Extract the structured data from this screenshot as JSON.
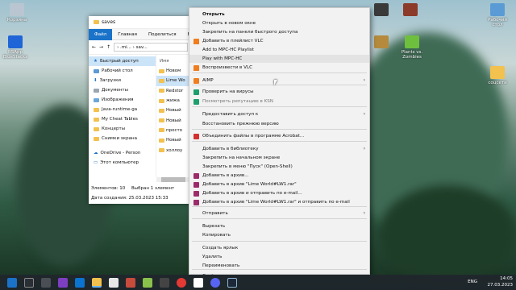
{
  "desktop": {
    "left_icons": [
      "Корзина",
      "BSApp\nBlueStacks"
    ],
    "right_icons": [
      "Рабочий\nстол",
      "Plants vs.\nZombies",
      "соцсети"
    ]
  },
  "explorer": {
    "title": "saves",
    "ribbon_tabs": [
      "Файл",
      "Главная",
      "Поделиться",
      "Вид"
    ],
    "path": "› .mi... › sav...",
    "column_header": "Имя",
    "nav_items": [
      "Быстрый доступ",
      "Рабочий стол",
      "Загрузки",
      "Документы",
      "Изображения",
      "Java-runtime-ga",
      "My Cheat Tables",
      "Концерты",
      "Снимки экрана",
      "OneDrive - Person",
      "Этот компьютер"
    ],
    "file_items": [
      "Новом",
      "Lime Wo",
      "Redstor",
      "жижа",
      "Новый",
      "Новый",
      "просто",
      "Новый",
      "холлоу"
    ],
    "status_elements": "Элементов: 10",
    "status_selected": "Выбран 1 элемент",
    "status_date": "Дата создания: 25.03.2023 15:33"
  },
  "context_menu": {
    "items": [
      {
        "label": "Открыть",
        "bold": true
      },
      {
        "label": "Открыть в новом окне"
      },
      {
        "label": "Закрепить на панели быстрого доступа"
      },
      {
        "label": "Добавить в плейлист VLC",
        "icon": "vlc-icon"
      },
      {
        "label": "Add to MPC-HC Playlist"
      },
      {
        "label": "Play with MPC-HC",
        "highlight": true
      },
      {
        "label": "Воспроизвести в VLC",
        "icon": "vlc-icon"
      },
      {
        "label": "AIMP",
        "icon": "aimp-icon",
        "submenu": true
      },
      {
        "label": "Проверить на вирусы",
        "icon": "shield-icon"
      },
      {
        "label": "Посмотреть репутацию в KSN",
        "icon": "shield-icon",
        "muted": true
      },
      {
        "label": "Предоставить доступ к",
        "submenu": true
      },
      {
        "label": "Восстановить прежнюю версию"
      },
      {
        "label": "Объединить файлы в программе Acrobat...",
        "icon": "acrobat-icon"
      },
      {
        "label": "Добавить в библиотеку",
        "submenu": true
      },
      {
        "label": "Закрепить на начальном экране"
      },
      {
        "label": "Закрепить в меню \"Пуск\" (Open-Shell)"
      },
      {
        "label": "Добавить в архив...",
        "icon": "winrar-icon"
      },
      {
        "label": "Добавить в архив \"Lime World#LW1.rar\"",
        "icon": "winrar-icon"
      },
      {
        "label": "Добавить в архив и отправить по e-mail...",
        "icon": "winrar-icon"
      },
      {
        "label": "Добавить в архив \"Lime World#LW1.rar\" и отправить по e-mail",
        "icon": "winrar-icon"
      },
      {
        "label": "Отправить",
        "submenu": true
      },
      {
        "label": "Вырезать"
      },
      {
        "label": "Копировать"
      },
      {
        "label": "Создать ярлык"
      },
      {
        "label": "Удалить"
      },
      {
        "label": "Переименовать"
      },
      {
        "label": "Свойства"
      }
    ]
  },
  "taskbar": {
    "lang": "ENG",
    "time": "14:05",
    "date": "27.03.2023"
  },
  "colors": {
    "accent": "#1a73c9",
    "vlc": "#f07d1e",
    "winrar": "#9b2b6a",
    "acrobat": "#d32f2f",
    "shield": "#1d9e6d"
  }
}
